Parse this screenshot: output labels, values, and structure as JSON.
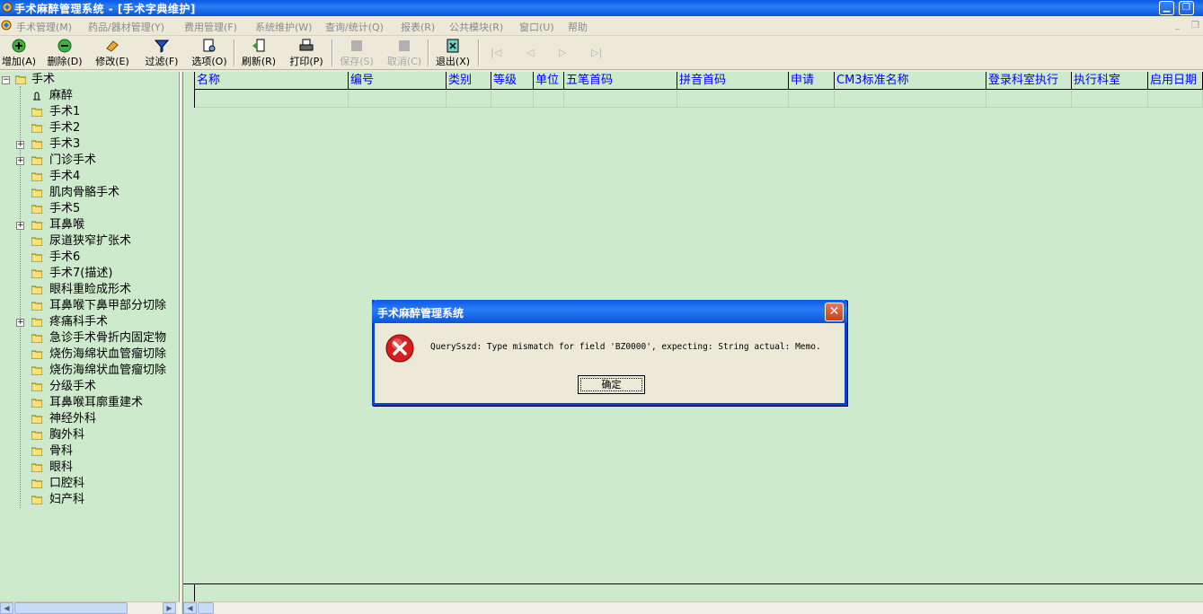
{
  "window": {
    "title": "手术麻醉管理系统 - [手术字典维护]"
  },
  "menu": [
    {
      "label": "手术管理(M)"
    },
    {
      "label": "药品/器材管理(Y)"
    },
    {
      "label": "费用管理(F)"
    },
    {
      "label": "系统维护(W)"
    },
    {
      "label": "查询/统计(Q)"
    },
    {
      "label": "报表(R)"
    },
    {
      "label": "公共模块(R)"
    },
    {
      "label": "窗口(U)"
    },
    {
      "label": "帮助"
    }
  ],
  "toolbar": [
    {
      "label": "增加(A)"
    },
    {
      "label": "删除(D)"
    },
    {
      "label": "修改(E)"
    },
    {
      "label": "过滤(F)"
    },
    {
      "label": "选项(O)"
    },
    {
      "label": "刷新(R)"
    },
    {
      "label": "打印(P)"
    },
    {
      "label": "保存(S)"
    },
    {
      "label": "取消(C)"
    },
    {
      "label": "退出(X)"
    }
  ],
  "tree": {
    "root": "手术",
    "items": [
      {
        "label": "麻醉",
        "expandable": false
      },
      {
        "label": "手术1",
        "expandable": false
      },
      {
        "label": "手术2",
        "expandable": false
      },
      {
        "label": "手术3",
        "expandable": true
      },
      {
        "label": "门诊手术",
        "expandable": true
      },
      {
        "label": "手术4",
        "expandable": false
      },
      {
        "label": "肌肉骨骼手术",
        "expandable": false
      },
      {
        "label": "手术5",
        "expandable": false
      },
      {
        "label": "耳鼻喉",
        "expandable": true
      },
      {
        "label": "尿道狭窄扩张术",
        "expandable": false
      },
      {
        "label": "手术6",
        "expandable": false
      },
      {
        "label": "手术7(描述)",
        "expandable": false
      },
      {
        "label": "眼科重睑成形术",
        "expandable": false
      },
      {
        "label": "耳鼻喉下鼻甲部分切除",
        "expandable": false
      },
      {
        "label": "疼痛科手术",
        "expandable": true
      },
      {
        "label": "急诊手术骨折内固定物",
        "expandable": false
      },
      {
        "label": "烧伤海绵状血管瘤切除",
        "expandable": false
      },
      {
        "label": "烧伤海绵状血管瘤切除",
        "expandable": false
      },
      {
        "label": "分级手术",
        "expandable": false
      },
      {
        "label": "耳鼻喉耳廓重建术",
        "expandable": false
      },
      {
        "label": "神经外科",
        "expandable": false
      },
      {
        "label": "胸外科",
        "expandable": false
      },
      {
        "label": "骨科",
        "expandable": false
      },
      {
        "label": "眼科",
        "expandable": false
      },
      {
        "label": "口腔科",
        "expandable": false
      },
      {
        "label": "妇产科",
        "expandable": false
      }
    ]
  },
  "grid": {
    "columns": [
      "名称",
      "编号",
      "类别",
      "等级",
      "单位",
      "五笔首码",
      "拼音首码",
      "申请",
      "CM3标准名称",
      "登录科室执行",
      "执行科室",
      "启用日期"
    ]
  },
  "dialog": {
    "title": "手术麻醉管理系统",
    "message": "QuerySszd: Type mismatch for field 'BZ0000', expecting: String actual: Memo.",
    "ok": "确定"
  },
  "colors": {
    "accent": "#0a5ae6",
    "grid_bg": "#cdeacd",
    "header_text": "#0000ff"
  }
}
